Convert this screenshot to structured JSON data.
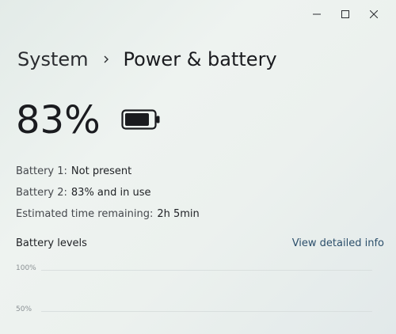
{
  "window": {
    "controls": {
      "minimize_icon": "minimize-icon",
      "maximize_icon": "maximize-icon",
      "close_icon": "close-icon"
    }
  },
  "breadcrumb": {
    "parent": "System",
    "separator_icon": "chevron-right-icon",
    "current": "Power & battery"
  },
  "battery": {
    "percent_text": "83%",
    "percent_value": 83,
    "icon": "battery-icon",
    "lines": [
      {
        "label": "Battery 1:",
        "value": "Not present"
      },
      {
        "label": "Battery 2:",
        "value": "83% and in use"
      },
      {
        "label": "Estimated time remaining:",
        "value": "2h 5min"
      }
    ]
  },
  "levels": {
    "title": "Battery levels",
    "link": "View detailed info",
    "link_color": "#2c4f6b",
    "ticks": [
      "100%",
      "50%"
    ]
  }
}
